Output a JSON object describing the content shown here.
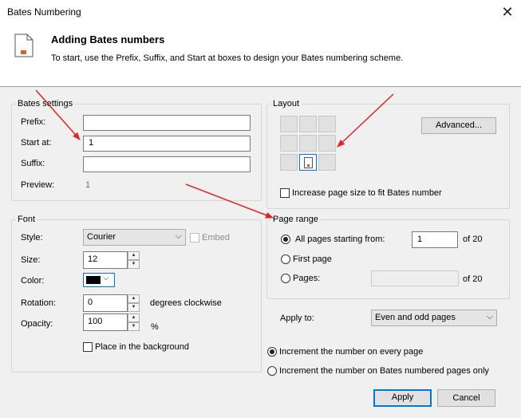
{
  "window": {
    "title": "Bates Numbering",
    "close_symbol": "✕"
  },
  "header": {
    "title": "Adding Bates numbers",
    "subtitle": "To start, use the Prefix, Suffix, and Start at boxes to design your Bates numbering scheme."
  },
  "bates_settings": {
    "legend": "Bates settings",
    "prefix_label": "Prefix:",
    "prefix_value": "",
    "start_label": "Start at:",
    "start_value": "1",
    "suffix_label": "Suffix:",
    "suffix_value": "",
    "preview_label": "Preview:",
    "preview_value": "1"
  },
  "font": {
    "legend": "Font",
    "style_label": "Style:",
    "style_value": "Courier",
    "embed_label": "Embed",
    "size_label": "Size:",
    "size_value": "12",
    "color_label": "Color:",
    "color_value": "#000000",
    "rotation_label": "Rotation:",
    "rotation_value": "0",
    "rotation_unit": "degrees clockwise",
    "opacity_label": "Opacity:",
    "opacity_value": "100",
    "opacity_unit": "%",
    "background_label": "Place in the background"
  },
  "layout": {
    "legend": "Layout",
    "advanced_label": "Advanced...",
    "selected_position": "bottom-center",
    "increase_label": "Increase page size to fit Bates number"
  },
  "page_range": {
    "legend": "Page range",
    "all_pages_label": "All pages starting from:",
    "all_pages_value": "1",
    "all_pages_of": "of 20",
    "first_page_label": "First page",
    "pages_label": "Pages:",
    "pages_value": "",
    "pages_of": "of 20",
    "selected": "all_pages"
  },
  "apply_to": {
    "label": "Apply to:",
    "value": "Even and odd pages"
  },
  "increment": {
    "every_page_label": "Increment the number on every page",
    "bates_only_label": "Increment the number on Bates numbered pages only",
    "selected": "every_page"
  },
  "buttons": {
    "apply": "Apply",
    "cancel": "Cancel"
  },
  "colors": {
    "accent": "#0078d7",
    "annotation_arrow": "#e02424",
    "page_icon": "#e06020"
  }
}
